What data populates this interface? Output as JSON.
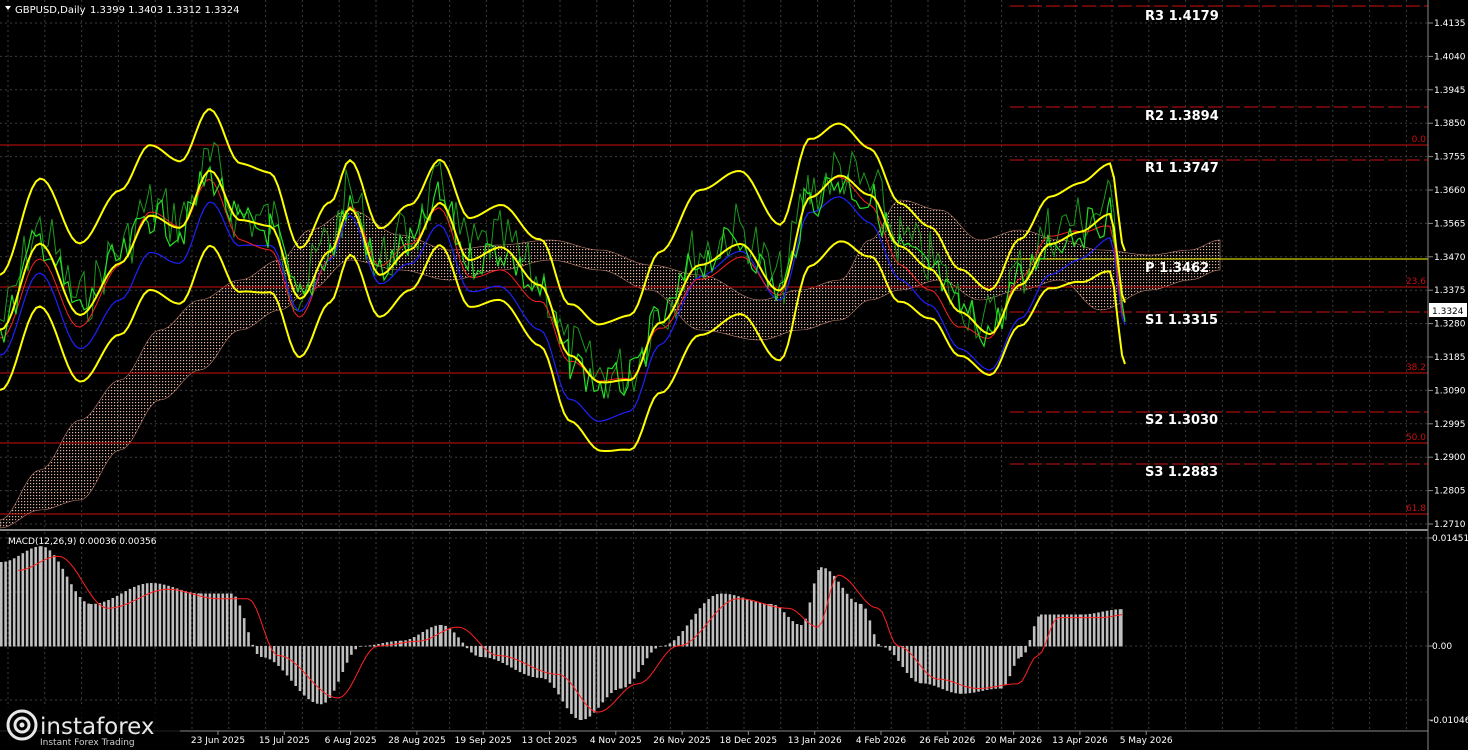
{
  "window": {
    "title": "GBPUSD,Daily",
    "ohlc": "1.3399 1.3403 1.3312 1.3324"
  },
  "price_axis": {
    "labels": [
      "1.4135",
      "1.4040",
      "1.3945",
      "1.3850",
      "1.3755",
      "1.3660",
      "1.3565",
      "1.3470",
      "1.3375",
      "1.3280",
      "1.3185",
      "1.3090",
      "1.2995",
      "1.2900",
      "1.2805",
      "1.2710"
    ],
    "current": "1.3324"
  },
  "pivots": {
    "r3": "R3 1.4179",
    "r2": "R2 1.3894",
    "r1": "R1 1.3747",
    "p": "P 1.3462",
    "s1": "S1 1.3315",
    "s2": "S2 1.3030",
    "s3": "S3 1.2883"
  },
  "fib": {
    "f0": "0.0",
    "f236": "23.6",
    "f382": "38.2",
    "f50": "50.0",
    "f618": "61.8"
  },
  "macd": {
    "label": "MACD(12,26,9) 0.00036 0.00356",
    "axis_top": "0.01451",
    "axis_zero": "0.00",
    "axis_bottom": "-0.01046"
  },
  "time_axis": {
    "labels": [
      "23 Jun 2025",
      "15 Jul 2025",
      "6 Aug 2025",
      "28 Aug 2025",
      "19 Sep 2025",
      "13 Oct 2025",
      "4 Nov 2025",
      "26 Nov 2025",
      "18 Dec 2025",
      "13 Jan 2026",
      "4 Feb 2026",
      "26 Feb 2026",
      "20 Mar 2026",
      "13 Apr 2026",
      "5 May 2026"
    ]
  },
  "brand": {
    "name": "instaforex",
    "tagline": "Instant Forex Trading"
  },
  "colors": {
    "background": "#000000",
    "grid": "#3a3a3a",
    "price_line": "#1bd41b",
    "bollinger": "#ffff00",
    "kijun": "#1e1eff",
    "tenkan": "#ff2020",
    "fib": "#d01010",
    "pivot": "#ffffff",
    "macd_hist": "#c0c0c0",
    "macd_signal": "#ff2020",
    "cloud": "#e0b0a0"
  }
}
